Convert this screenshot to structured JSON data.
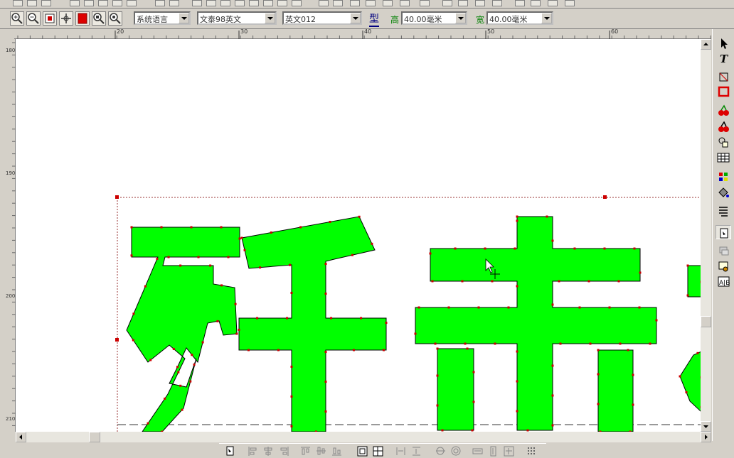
{
  "toolbar": {
    "language_combo": {
      "value": "系统语言"
    },
    "chinese_font_combo": {
      "value": "文泰98英文"
    },
    "english_font_combo": {
      "value": "英文012"
    },
    "type_label": "型",
    "height_label": "高",
    "height_combo": {
      "value": "40.00毫米"
    },
    "width_label": "宽",
    "width_combo": {
      "value": "40.00毫米"
    }
  },
  "ruler": {
    "horizontal_labels": [
      "20",
      "30",
      "40",
      "50",
      "60"
    ],
    "vertical_labels": [
      "180",
      "190",
      "200",
      "210"
    ]
  },
  "canvas": {
    "text_characters": [
      "歼",
      "击"
    ],
    "text_fill_color": "#00ff00",
    "outline_color": "#000000",
    "node_color": "#cc0000"
  },
  "icons": {
    "top_toolbar": [
      "zoom-in-icon",
      "zoom-out-icon",
      "zoom-page-icon",
      "pan-icon",
      "color-square-icon",
      "zoom-window-icon",
      "zoom-selection-icon"
    ],
    "right_toolbar": [
      "select-arrow-icon",
      "text-tool-icon",
      "shape-tool-icon",
      "rectangle-icon",
      "fill-tool-icon",
      "outline-tool-icon",
      "transform-icon",
      "table-icon",
      "color-palette-icon",
      "paint-bucket-icon",
      "paragraph-icon",
      "page-icon",
      "layers-icon",
      "frame-icon",
      "text-ab-icon"
    ],
    "bottom_toolbar": [
      "page-icon",
      "align-left-icon",
      "align-center-icon",
      "align-right-icon",
      "align-top-icon",
      "align-middle-icon",
      "align-bottom-icon",
      "center-page-icon",
      "center-selection-icon",
      "distribute-h-icon",
      "distribute-v-icon",
      "group-icon",
      "circle-icon",
      "same-width-icon",
      "same-height-icon",
      "same-size-icon",
      "grid-icon"
    ]
  }
}
